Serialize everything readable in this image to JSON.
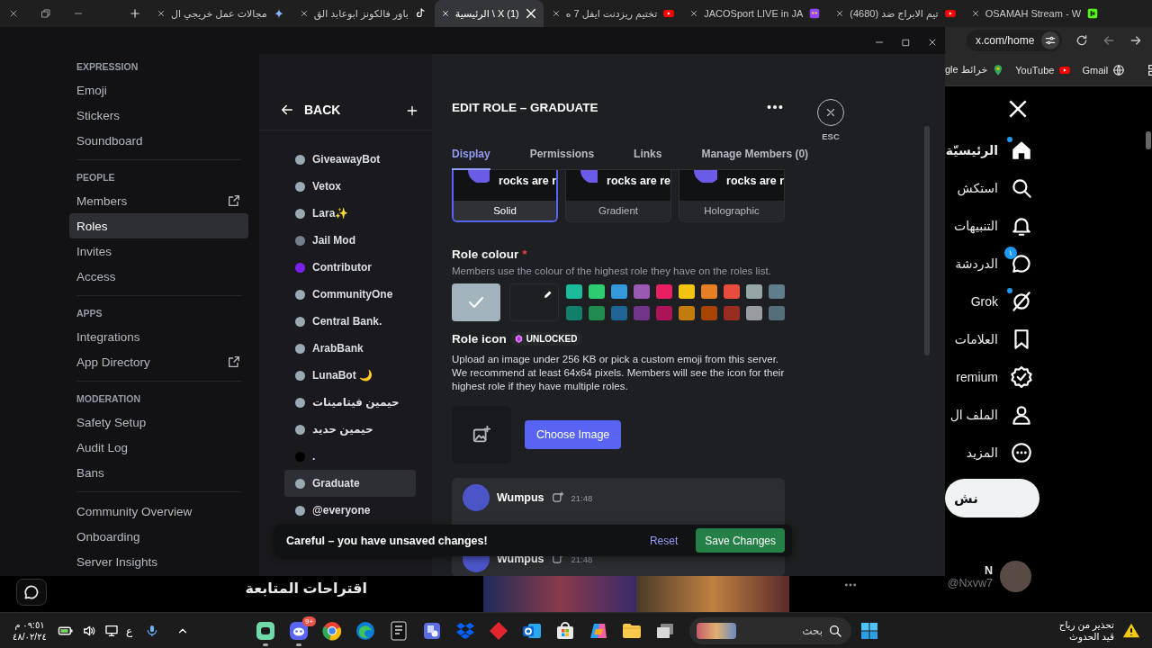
{
  "browser": {
    "tabs": [
      {
        "title": "OSAMAH Stream - W",
        "selected": false
      },
      {
        "title": "(4680) تيم الابراج ضد",
        "selected": false
      },
      {
        "title": "JACOSport LIVE in JA",
        "selected": false
      },
      {
        "title": "تختيم ريزدنت ايفل 7 ه",
        "selected": false
      },
      {
        "title": "الرئيسية \\ X (1)",
        "selected": true
      },
      {
        "title": "باور فالكونز ابوعابد الق",
        "selected": false
      },
      {
        "title": "مجالات عمل خريجي ال",
        "selected": false
      }
    ],
    "address": "x.com/home",
    "bookmarks": [
      {
        "label": "gle خرائط"
      },
      {
        "label": "YouTube"
      },
      {
        "label": "Gmail"
      }
    ]
  },
  "discord": {
    "sidebar": [
      {
        "header": "EXPRESSION",
        "items": [
          {
            "label": "Emoji",
            "selected": false,
            "external": false
          },
          {
            "label": "Stickers",
            "selected": false,
            "external": false
          },
          {
            "label": "Soundboard",
            "selected": false,
            "external": false
          }
        ]
      },
      {
        "header": "PEOPLE",
        "items": [
          {
            "label": "Members",
            "selected": false,
            "external": true
          },
          {
            "label": "Roles",
            "selected": true,
            "external": false
          },
          {
            "label": "Invites",
            "selected": false,
            "external": false
          },
          {
            "label": "Access",
            "selected": false,
            "external": false
          }
        ]
      },
      {
        "header": "APPS",
        "items": [
          {
            "label": "Integrations",
            "selected": false,
            "external": false
          },
          {
            "label": "App Directory",
            "selected": false,
            "external": true
          }
        ]
      },
      {
        "header": "MODERATION",
        "items": [
          {
            "label": "Safety Setup",
            "selected": false,
            "external": false
          },
          {
            "label": "Audit Log",
            "selected": false,
            "external": false
          },
          {
            "label": "Bans",
            "selected": false,
            "external": false
          }
        ]
      },
      {
        "items": [
          {
            "label": "Community Overview",
            "selected": false,
            "external": false
          },
          {
            "label": "Onboarding",
            "selected": false,
            "external": false
          },
          {
            "label": "Server Insights",
            "selected": false,
            "external": false
          }
        ]
      }
    ],
    "roles": {
      "back": "BACK",
      "items": [
        {
          "name": "GiveawayBot",
          "color": "#99aab5",
          "selected": false
        },
        {
          "name": "Vetox",
          "color": "#99aab5",
          "selected": false
        },
        {
          "name": "Lara✨",
          "color": "#99aab5",
          "selected": false
        },
        {
          "name": "Jail Mod",
          "color": "#747f8d",
          "selected": false
        },
        {
          "name": "Contributor",
          "color": "#7b20f0",
          "selected": false
        },
        {
          "name": "CommunityOne",
          "color": "#99aab5",
          "selected": false
        },
        {
          "name": "Central Bank.",
          "color": "#99aab5",
          "selected": false
        },
        {
          "name": "ArabBank",
          "color": "#99aab5",
          "selected": false
        },
        {
          "name": "LunaBot 🌙",
          "color": "#99aab5",
          "selected": false
        },
        {
          "name": "حيمين فيتامينات",
          "color": "#99aab5",
          "selected": false
        },
        {
          "name": "حيمين حديد",
          "color": "#99aab5",
          "selected": false
        },
        {
          "name": ".",
          "color": "#000000",
          "selected": false
        },
        {
          "name": "Graduate",
          "color": "#99aab5",
          "selected": true
        },
        {
          "name": "@everyone",
          "color": "#99aab5",
          "selected": false
        }
      ]
    },
    "editor": {
      "title": "EDIT ROLE – GRADUATE",
      "close_label": "ESC",
      "tabs": [
        {
          "label": "Display",
          "selected": true
        },
        {
          "label": "Permissions",
          "selected": false
        },
        {
          "label": "Links",
          "selected": false
        },
        {
          "label": "Manage Members (0)",
          "selected": false
        }
      ],
      "styles": [
        {
          "label": "Solid",
          "preview": "rocks are r",
          "selected": true
        },
        {
          "label": "Gradient",
          "preview": "rocks are re",
          "selected": false
        },
        {
          "label": "Holographic",
          "preview": "rocks are r",
          "selected": false
        }
      ],
      "role_colour": {
        "label": "Role colour",
        "required_mark": "*",
        "description": "Members use the colour of the highest role they have on the roles list.",
        "swatches": [
          {
            "kind": "default",
            "color": "#a3b4bc",
            "selected": true
          },
          {
            "kind": "custom",
            "color": "#1e1f22",
            "selected": false
          },
          {
            "kind": "preset",
            "color": "#1abc9c",
            "selected": false
          },
          {
            "kind": "preset",
            "color": "#2ecc71",
            "selected": false
          },
          {
            "kind": "preset",
            "color": "#3498db",
            "selected": false
          },
          {
            "kind": "preset",
            "color": "#9b59b6",
            "selected": false
          },
          {
            "kind": "preset",
            "color": "#e91e63",
            "selected": false
          },
          {
            "kind": "preset",
            "color": "#f1c40f",
            "selected": false
          },
          {
            "kind": "preset",
            "color": "#e67e22",
            "selected": false
          },
          {
            "kind": "preset",
            "color": "#e74c3c",
            "selected": false
          },
          {
            "kind": "preset",
            "color": "#95a5a6",
            "selected": false
          },
          {
            "kind": "preset",
            "color": "#607d8b",
            "selected": false
          },
          {
            "kind": "preset",
            "color": "#11806a",
            "selected": false
          },
          {
            "kind": "preset",
            "color": "#1f8b4c",
            "selected": false
          },
          {
            "kind": "preset",
            "color": "#206694",
            "selected": false
          },
          {
            "kind": "preset",
            "color": "#71368a",
            "selected": false
          },
          {
            "kind": "preset",
            "color": "#ad1457",
            "selected": false
          },
          {
            "kind": "preset",
            "color": "#c27c0e",
            "selected": false
          },
          {
            "kind": "preset",
            "color": "#a84300",
            "selected": false
          },
          {
            "kind": "preset",
            "color": "#992d22",
            "selected": false
          },
          {
            "kind": "preset",
            "color": "#979c9f",
            "selected": false
          },
          {
            "kind": "preset",
            "color": "#546e7a",
            "selected": false
          }
        ]
      },
      "role_icon": {
        "label": "Role icon",
        "badge": "UNLOCKED",
        "description": "Upload an image under 256 KB or pick a custom emoji from this server. We recommend at least 64x64 pixels. Members will see the icon for their highest role if they have multiple roles.",
        "button": "Choose Image"
      },
      "preview": [
        {
          "author": "Wumpus",
          "time": "21:48"
        },
        {
          "author": "Wumpus",
          "time": "21:48"
        }
      ],
      "unsaved": {
        "message": "Careful – you have unsaved changes!",
        "reset": "Reset",
        "save": "Save Changes"
      }
    }
  },
  "x_page": {
    "nav": [
      {
        "label": "الرئيسيّة",
        "selected": true,
        "unread": true
      },
      {
        "label": "استكش",
        "selected": false,
        "unread": false
      },
      {
        "label": "التنبيهات",
        "selected": false,
        "unread": false
      },
      {
        "label": "الدردشة",
        "selected": false,
        "unread": false,
        "badge": "١"
      },
      {
        "label": "Grok",
        "selected": false,
        "unread": true
      },
      {
        "label": "العلامات",
        "selected": false,
        "unread": false
      },
      {
        "label": "remium",
        "selected": false,
        "unread": false
      },
      {
        "label": "الملف ال",
        "selected": false,
        "unread": false
      },
      {
        "label": "المزيد",
        "selected": false,
        "unread": false
      }
    ],
    "post_button": "نش",
    "account": {
      "name": "N",
      "handle": "@Nxvw7"
    },
    "follow_heading": "اقتراحات المتابعة"
  },
  "taskbar": {
    "clock": {
      "time": "٠٩:٥١ م",
      "date": "٤٨/٠٢/٢٤"
    },
    "language": "ع",
    "apps": [
      {
        "running": true
      },
      {
        "running": true,
        "badge": "9+"
      },
      {
        "running": false
      },
      {
        "running": false
      },
      {
        "running": false
      },
      {
        "running": false
      },
      {
        "running": false
      },
      {
        "running": false
      },
      {
        "running": false
      },
      {
        "running": false
      },
      {
        "running": false
      },
      {
        "running": false
      },
      {
        "running": false
      }
    ],
    "search": {
      "placeholder": "بحث"
    },
    "weather": {
      "title": "تحذير من رياح",
      "subtitle": "قيد الحدوث"
    }
  }
}
